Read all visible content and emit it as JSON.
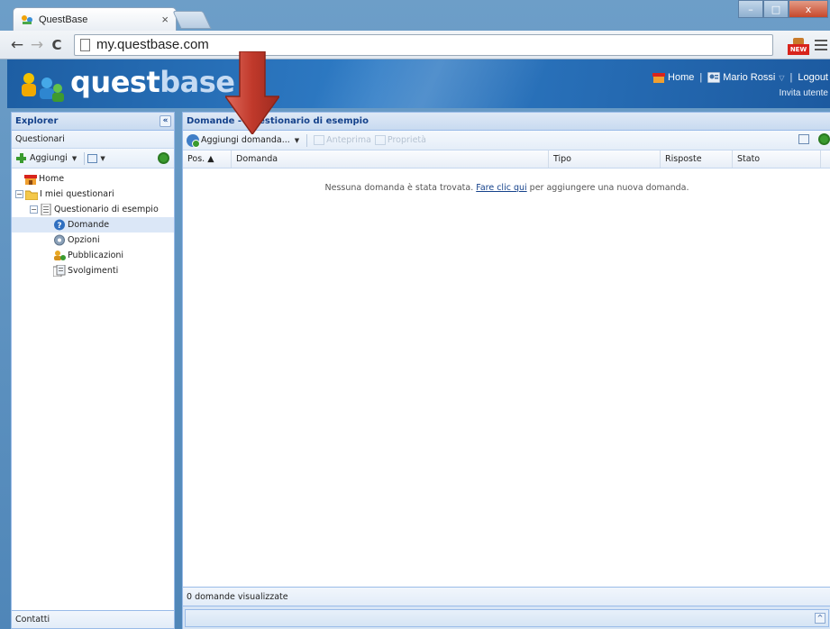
{
  "browser": {
    "tab_title": "QuestBase",
    "tab_close": "×",
    "url": "my.questbase.com",
    "back": "←",
    "forward": "→",
    "reload": "C",
    "window_buttons": {
      "minimize": "–",
      "maximize": "□",
      "close": "x"
    },
    "extension_badge": "NEW"
  },
  "app": {
    "logo_bold": "quest",
    "logo_light": "base",
    "header_links": {
      "home": "Home",
      "user": "Mario Rossi",
      "logout": "Logout",
      "sep1": "|",
      "sep2": "|"
    },
    "invite": "Invita utente"
  },
  "explorer": {
    "title": "Explorer",
    "collapse": "«",
    "subtitle": "Questionari",
    "add_label": "Aggiungi",
    "tree": {
      "home": "Home",
      "my_surveys": "I miei questionari",
      "sample_survey": "Questionario di esempio",
      "questions": "Domande",
      "options": "Opzioni",
      "publications": "Pubblicazioni",
      "runs": "Svolgimenti"
    },
    "footer": "Contatti"
  },
  "main": {
    "title": "Domande - Questionario di esempio",
    "toolbar": {
      "add_question": "Aggiungi domanda...",
      "preview": "Anteprima",
      "properties": "Proprietà"
    },
    "columns": [
      "Pos. ▲",
      "Domanda",
      "Tipo",
      "Risposte",
      "Stato"
    ],
    "empty_text_before": "Nessuna domanda è stata trovata. ",
    "empty_link": "Fare clic qui",
    "empty_text_after": " per aggiungere una nuova domanda.",
    "status": "0 domande visualizzate",
    "expand": "^"
  },
  "colors": {
    "accent": "#15428b",
    "header_blue": "#2f7cc6",
    "arrow_red": "#c0392b"
  }
}
